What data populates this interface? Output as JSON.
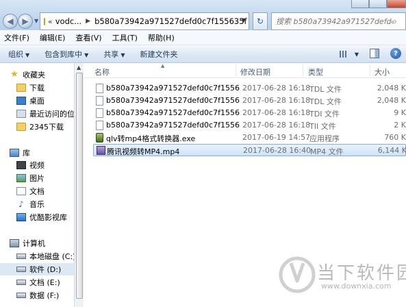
{
  "window": {
    "address_segments": [
      "vodc...",
      "b580a73942a971527defd0c7f155635f"
    ],
    "search_placeholder": "搜索 b580a73942a971527defd0c7f155635f"
  },
  "menu": [
    "文件(F)",
    "编辑(E)",
    "查看(V)",
    "工具(T)",
    "帮助(H)"
  ],
  "toolbar": {
    "organize": "组织",
    "include_library": "包含到库中",
    "share": "共享",
    "new_folder": "新建文件夹"
  },
  "nav": {
    "favorites": "收藏夹",
    "favorites_items": [
      "下载",
      "桌面",
      "最近访问的位置",
      "2345下载"
    ],
    "library": "库",
    "library_items": [
      "视频",
      "图片",
      "文档",
      "音乐",
      "优酷影视库"
    ],
    "computer": "计算机",
    "drives": [
      "本地磁盘 (C:)",
      "软件 (D:)",
      "文档 (E:)",
      "数据 (F:)"
    ]
  },
  "columns": {
    "name": "名称",
    "date": "修改日期",
    "type": "类型",
    "size": "大小"
  },
  "files": [
    {
      "name": "b580a73942a971527defd0c7f155635f...",
      "date": "2017-06-28 16:18",
      "type": "TDL 文件",
      "size": "2,048 K",
      "icon": "generic-file-icon"
    },
    {
      "name": "b580a73942a971527defd0c7f155635f...",
      "date": "2017-06-28 16:18",
      "type": "TDL 文件",
      "size": "2,048 K",
      "icon": "generic-file-icon"
    },
    {
      "name": "b580a73942a971527defd0c7f155635f...",
      "date": "2017-06-28 16:18",
      "type": "TDI 文件",
      "size": "9 K",
      "icon": "generic-file-icon"
    },
    {
      "name": "b580a73942a971527defd0c7f155635f...",
      "date": "2017-06-28 16:18",
      "type": "TII 文件",
      "size": "2 K",
      "icon": "generic-file-icon"
    },
    {
      "name": "qlv转mp4格式转换器.exe",
      "date": "2017-06-19 14:57",
      "type": "应用程序",
      "size": "760 K",
      "icon": "exe-icon"
    },
    {
      "name": "腾讯视频转MP4.mp4",
      "date": "2017-06-28 16:40",
      "type": "MP4 文件",
      "size": "6,144 K",
      "icon": "mp4-icon"
    }
  ],
  "watermark": {
    "brand": "当下软件园",
    "url": "www.downxia.com"
  }
}
